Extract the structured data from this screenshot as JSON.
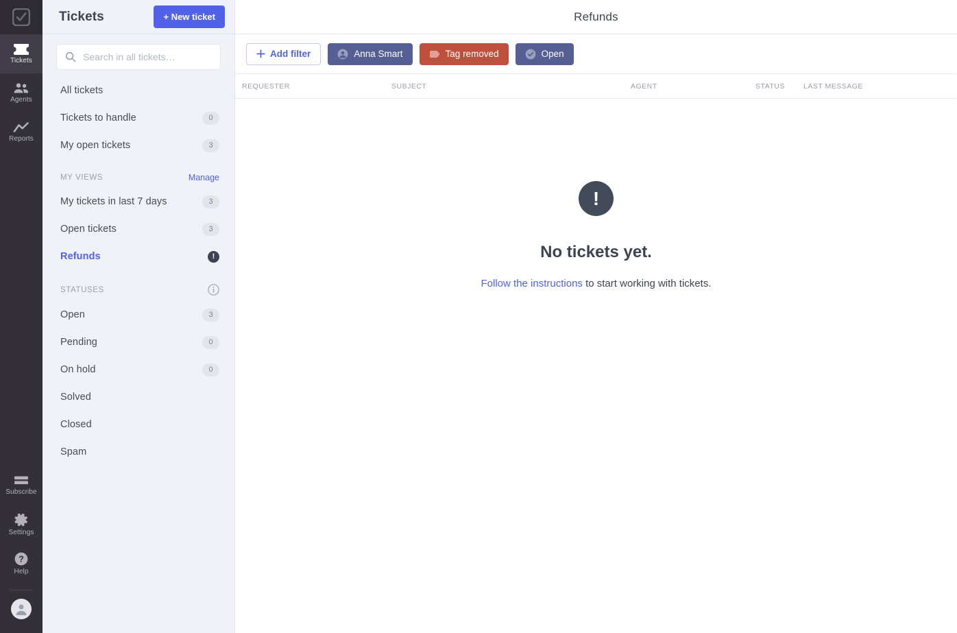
{
  "rail": {
    "logo_icon": "checkbox-logo-icon",
    "items": [
      {
        "label": "Tickets",
        "icon": "ticket-icon",
        "active": true
      },
      {
        "label": "Agents",
        "icon": "people-icon",
        "active": false
      },
      {
        "label": "Reports",
        "icon": "trend-line-icon",
        "active": false
      }
    ],
    "bottom_items": [
      {
        "label": "Subscribe",
        "icon": "credit-card-icon"
      },
      {
        "label": "Settings",
        "icon": "gear-icon"
      },
      {
        "label": "Help",
        "icon": "question-circle-icon"
      }
    ],
    "avatar_icon": "user-avatar-icon"
  },
  "sidebar": {
    "title": "Tickets",
    "new_ticket_label": "+ New ticket",
    "search": {
      "placeholder": "Search in all tickets…",
      "value": "",
      "icon": "search-icon"
    },
    "primary_items": [
      {
        "label": "All tickets",
        "count": null
      },
      {
        "label": "Tickets to handle",
        "count": "0"
      },
      {
        "label": "My open tickets",
        "count": "3"
      }
    ],
    "my_views": {
      "title": "MY VIEWS",
      "action": "Manage",
      "items": [
        {
          "label": "My tickets in last 7 days",
          "count": "3",
          "selected": false
        },
        {
          "label": "Open tickets",
          "count": "3",
          "selected": false
        },
        {
          "label": "Refunds",
          "alert": "!",
          "selected": true
        }
      ]
    },
    "statuses": {
      "title": "STATUSES",
      "info_icon": "info-circle-icon",
      "items": [
        {
          "label": "Open",
          "count": "3"
        },
        {
          "label": "Pending",
          "count": "0"
        },
        {
          "label": "On hold",
          "count": "0"
        },
        {
          "label": "Solved",
          "count": null
        },
        {
          "label": "Closed",
          "count": null
        },
        {
          "label": "Spam",
          "count": null
        }
      ]
    }
  },
  "main": {
    "title": "Refunds",
    "filters": {
      "add_label": "Add filter",
      "add_icon": "plus-icon",
      "chips": [
        {
          "label": "Anna Smart",
          "icon": "person-circle-icon",
          "color": "#565f94"
        },
        {
          "label": "Tag removed",
          "icon": "tag-icon",
          "color": "#c0503e"
        },
        {
          "label": "Open",
          "icon": "check-circle-icon",
          "color": "#565f94"
        }
      ]
    },
    "table": {
      "columns": [
        "REQUESTER",
        "SUBJECT",
        "AGENT",
        "STATUS",
        "LAST MESSAGE"
      ],
      "rows": []
    },
    "empty_state": {
      "icon": "exclamation-circle-icon",
      "icon_glyph": "!",
      "title": "No tickets yet.",
      "link_text": "Follow the instructions",
      "sub_text": " to start working with tickets."
    }
  },
  "colors": {
    "accent": "#5161e8",
    "rail_bg": "#33303a",
    "sidebar_bg": "#eff2f6",
    "chip_slate": "#565f94",
    "chip_red": "#c0503e",
    "dark_badge": "#3d4351"
  }
}
